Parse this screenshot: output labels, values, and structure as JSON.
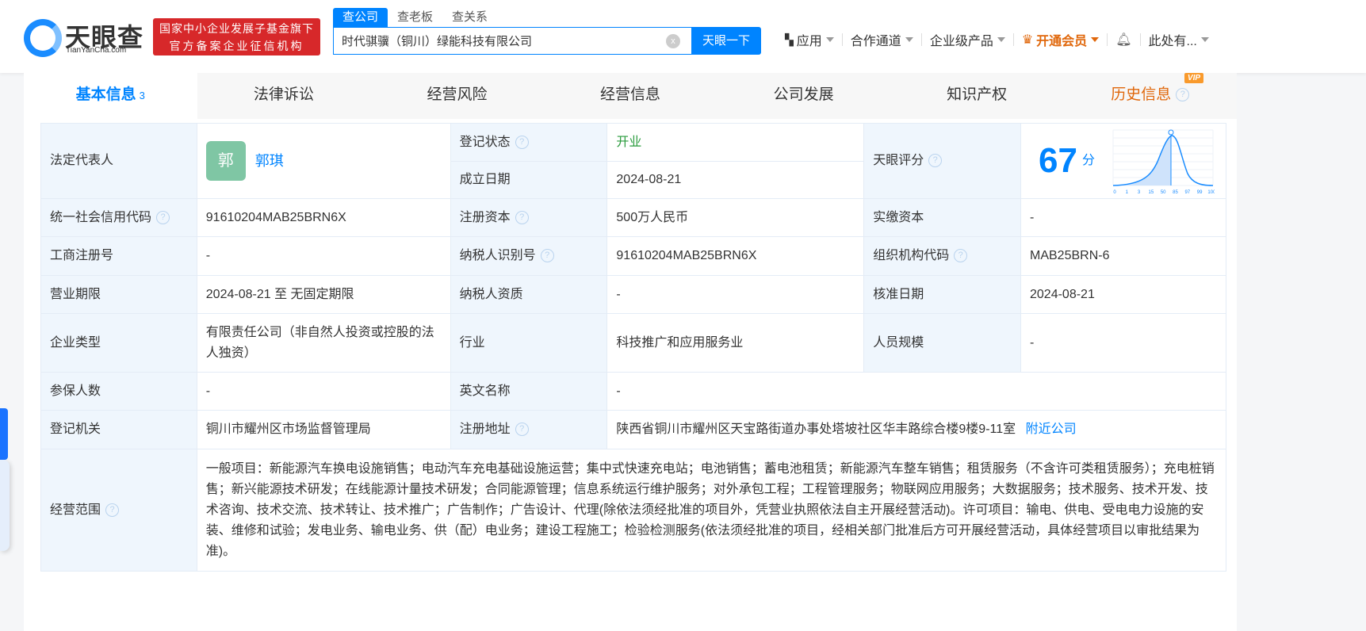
{
  "header": {
    "logo_name": "天眼查",
    "logo_domain": "TianYanCha.com",
    "badge_line1": "国家中小企业发展子基金旗下",
    "badge_line2": "官方备案企业征信机构",
    "search_tabs": [
      "查公司",
      "查老板",
      "查关系"
    ],
    "search_value": "时代骐骥（铜川）绿能科技有限公司",
    "search_button": "天眼一下",
    "nav": {
      "apps": "应用",
      "partner": "合作通道",
      "enterprise": "企业级产品",
      "vip": "开通会员",
      "user": "此处有..."
    }
  },
  "tabs": [
    {
      "label": "基本信息",
      "count": "3"
    },
    {
      "label": "法律诉讼"
    },
    {
      "label": "经营风险"
    },
    {
      "label": "经营信息"
    },
    {
      "label": "公司发展"
    },
    {
      "label": "知识产权"
    },
    {
      "label": "历史信息",
      "badge": "VIP"
    }
  ],
  "info": {
    "legal_rep_label": "法定代表人",
    "legal_rep_avatar": "郭",
    "legal_rep": "郭琪",
    "status_label": "登记状态",
    "status": "开业",
    "founded_label": "成立日期",
    "founded": "2024-08-21",
    "score_label": "天眼评分",
    "score": "67",
    "score_unit": "分",
    "score_ticks": [
      "0",
      "1",
      "3",
      "15",
      "50",
      "85",
      "97",
      "99",
      "100"
    ],
    "credit_code_label": "统一社会信用代码",
    "credit_code": "91610204MAB25BRN6X",
    "reg_capital_label": "注册资本",
    "reg_capital": "500万人民币",
    "paid_capital_label": "实缴资本",
    "paid_capital": "-",
    "biz_reg_no_label": "工商注册号",
    "biz_reg_no": "-",
    "taxpayer_id_label": "纳税人识别号",
    "taxpayer_id": "91610204MAB25BRN6X",
    "org_code_label": "组织机构代码",
    "org_code": "MAB25BRN-6",
    "term_label": "营业期限",
    "term": "2024-08-21 至 无固定期限",
    "taxpayer_qual_label": "纳税人资质",
    "taxpayer_qual": "-",
    "approved_label": "核准日期",
    "approved": "2024-08-21",
    "type_label": "企业类型",
    "type": "有限责任公司（非自然人投资或控股的法人独资）",
    "industry_label": "行业",
    "industry": "科技推广和应用服务业",
    "staff_label": "人员规模",
    "staff": "-",
    "insured_label": "参保人数",
    "insured": "-",
    "english_label": "英文名称",
    "english": "-",
    "authority_label": "登记机关",
    "authority": "铜川市耀州区市场监督管理局",
    "address_label": "注册地址",
    "address": "陕西省铜川市耀州区天宝路街道办事处塔坡社区华丰路综合楼9楼9-11室",
    "nearby": "附近公司",
    "scope_label": "经营范围",
    "scope": "一般项目：新能源汽车换电设施销售；电动汽车充电基础设施运营；集中式快速充电站；电池销售；蓄电池租赁；新能源汽车整车销售；租赁服务（不含许可类租赁服务）；充电桩销售；新兴能源技术研发；在线能源计量技术研发；合同能源管理；信息系统运行维护服务；对外承包工程；工程管理服务；物联网应用服务；大数据服务；技术服务、技术开发、技术咨询、技术交流、技术转让、技术推广；广告制作；广告设计、代理(除依法须经批准的项目外，凭营业执照依法自主开展经营活动)。许可项目：输电、供电、受电电力设施的安装、维修和试验；发电业务、输电业务、供（配）电业务；建设工程施工；检验检测服务(依法须经批准的项目，经相关部门批准后方可开展经营活动，具体经营项目以审批结果为准)。"
  }
}
